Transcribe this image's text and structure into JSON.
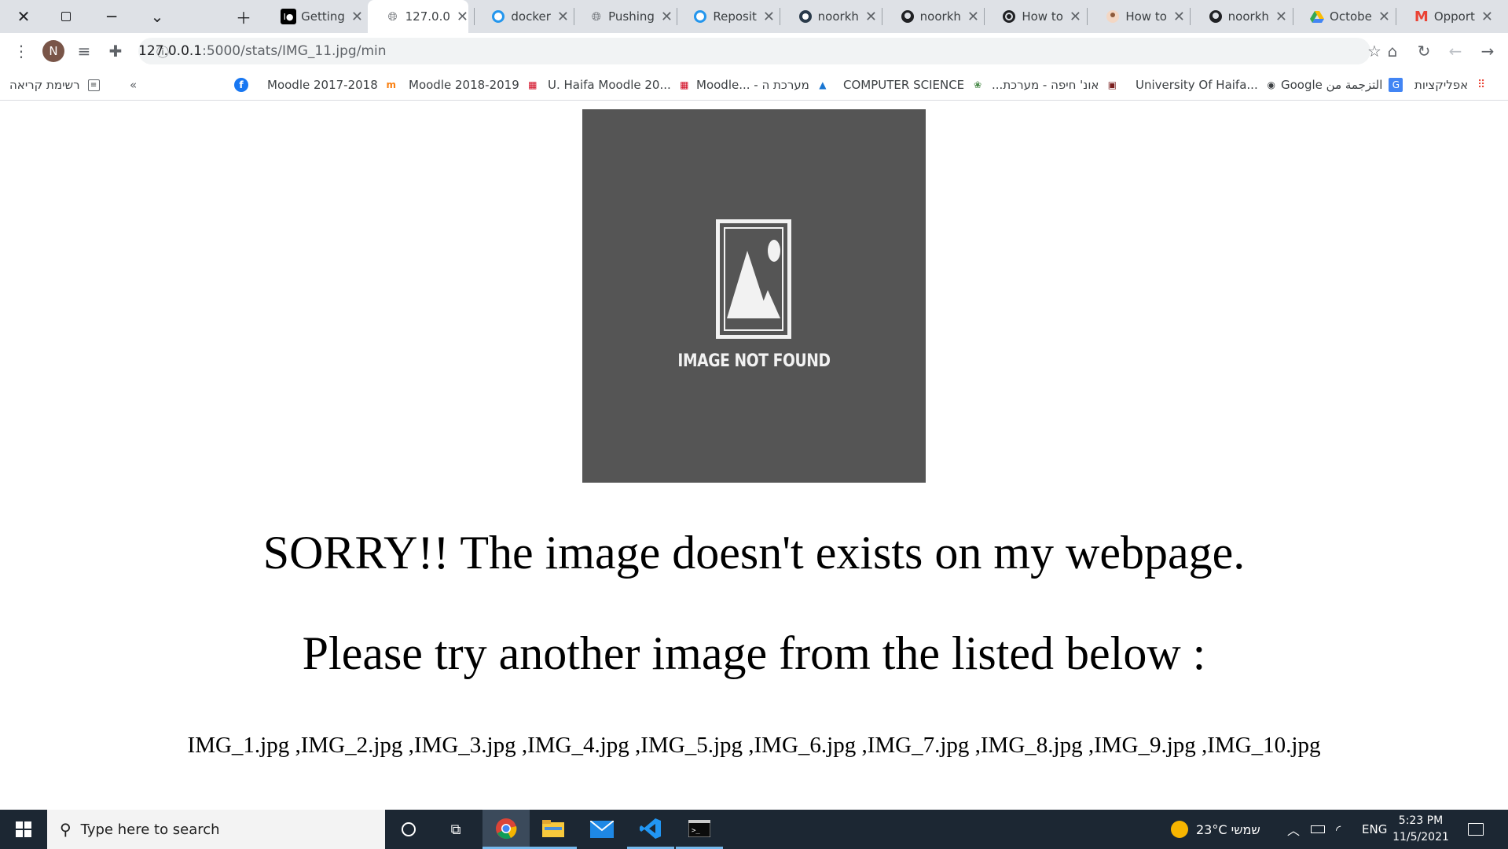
{
  "browser": {
    "tabs": [
      {
        "title": "Getting",
        "icon": "medium-icon"
      },
      {
        "title": "127.0.0",
        "icon": "globe-icon",
        "active": true
      },
      {
        "title": "docker",
        "icon": "docker-icon"
      },
      {
        "title": "Pushing",
        "icon": "globe-icon"
      },
      {
        "title": "Reposit",
        "icon": "docker-icon"
      },
      {
        "title": "noorkh",
        "icon": "docker-hub-icon"
      },
      {
        "title": "noorkh",
        "icon": "github-icon"
      },
      {
        "title": "How to",
        "icon": "circle-c-icon"
      },
      {
        "title": "How to",
        "icon": "avatar-icon"
      },
      {
        "title": "noorkh",
        "icon": "github-icon"
      },
      {
        "title": "Octobe",
        "icon": "google-drive-icon"
      },
      {
        "title": "Opport",
        "icon": "gmail-icon"
      }
    ],
    "url": {
      "host": "127.0.0.1",
      "path": ":5000/stats/IMG_11.jpg/min"
    },
    "profile_initial": "N",
    "bookmarks": [
      {
        "label": "אפליקציות",
        "icon": "apps-grid-icon"
      },
      {
        "label": "Google التزجمة من",
        "icon": "google-translate-icon"
      },
      {
        "label": "University Of Haifa...",
        "icon": "globe-icon"
      },
      {
        "label": "...אונ' חיפה - מערכת",
        "icon": "haifa-icon"
      },
      {
        "label": "COMPUTER SCIENCE",
        "icon": "haifa-cs-icon"
      },
      {
        "label": "Moodle... - מערכת ה",
        "icon": "moodle-icon"
      },
      {
        "label": "U. Haifa Moodle 20...",
        "icon": "moodle-icon"
      },
      {
        "label": "Moodle 2018-2019",
        "icon": "moodle-icon"
      },
      {
        "label": "Moodle 2017-2018",
        "icon": "moodle-icon"
      },
      {
        "label": "",
        "icon": "facebook-icon"
      }
    ],
    "reading_list_label": "רשימת קריאה"
  },
  "page": {
    "image_placeholder_text": "IMAGE NOT FOUND",
    "heading_sorry": "SORRY!! The image doesn't exists on my webpage.",
    "heading_try": "Please try another image from the listed below :",
    "image_list": "IMG_1.jpg ,IMG_2.jpg ,IMG_3.jpg ,IMG_4.jpg ,IMG_5.jpg ,IMG_6.jpg ,IMG_7.jpg ,IMG_8.jpg ,IMG_9.jpg ,IMG_10.jpg"
  },
  "taskbar": {
    "search_placeholder": "Type here to search",
    "weather": "23°C  שמשי",
    "language": "ENG",
    "time": "5:23 PM",
    "date": "11/5/2021"
  }
}
